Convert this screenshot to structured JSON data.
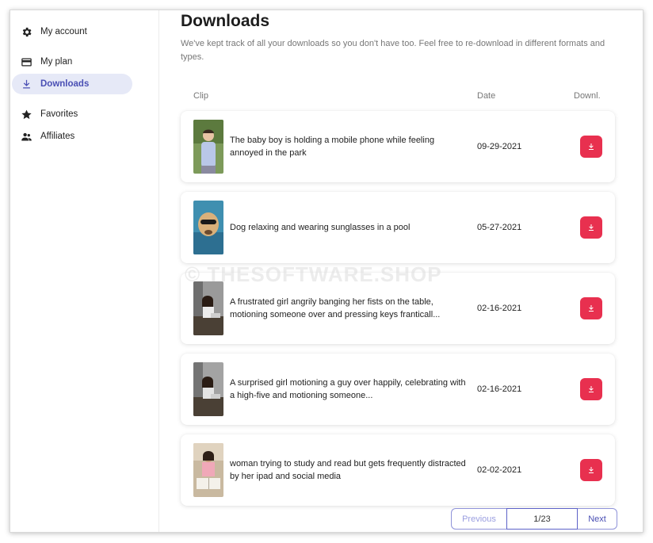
{
  "sidebar": {
    "items": [
      {
        "label": "My account",
        "icon": "gear-icon"
      },
      {
        "label": "My plan",
        "icon": "credit-card-icon"
      },
      {
        "label": "Downloads",
        "icon": "download-icon",
        "active": true
      },
      {
        "label": "Favorites",
        "icon": "star-icon"
      },
      {
        "label": "Affiliates",
        "icon": "people-icon"
      }
    ]
  },
  "main": {
    "title": "Downloads",
    "subtitle": "We've kept track of all your downloads so you don't have too. Feel free to re-download in different formats and types."
  },
  "table": {
    "headers": {
      "clip": "Clip",
      "date": "Date",
      "download": "Downl."
    },
    "rows": [
      {
        "clip": "The baby boy is holding a mobile phone while feeling annoyed in the park",
        "date": "09-29-2021",
        "thumb": "baby-boy-park"
      },
      {
        "clip": "Dog relaxing and wearing sunglasses in a pool",
        "date": "05-27-2021",
        "thumb": "dog-pool"
      },
      {
        "clip": "A frustrated girl angrily banging her fists on the table, motioning someone over and pressing keys franticall...",
        "date": "02-16-2021",
        "thumb": "girl-desk"
      },
      {
        "clip": "A surprised girl motioning a guy over happily, celebrating with a high-five and motioning someone...",
        "date": "02-16-2021",
        "thumb": "girl-desk-2"
      },
      {
        "clip": "woman trying to study and read but gets frequently distracted by her ipad and social media",
        "date": "02-02-2021",
        "thumb": "woman-study"
      }
    ]
  },
  "pagination": {
    "previous": "Previous",
    "page": "1/23",
    "next": "Next"
  },
  "watermark": "© THESOFTWARE.SHOP",
  "colors": {
    "accent": "#4a4fb4",
    "active_bg": "#e6e9f7",
    "download_button": "#e8304f"
  }
}
